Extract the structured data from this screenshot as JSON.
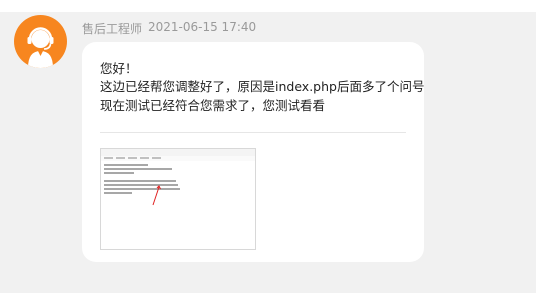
{
  "sender": {
    "name": "售后工程师",
    "timestamp": "2021-06-15 17:40",
    "avatar_icon": "support-agent-headset-icon",
    "avatar_color": "#f7861f"
  },
  "message": {
    "lines": [
      "您好！",
      "这边已经帮您调整好了，原因是index.php后面多了个问号",
      "现在测试已经符合您需求了，您测试看看"
    ],
    "attachment": {
      "type": "screenshot-thumbnail",
      "description_icon": "notepad-screenshot-icon"
    }
  }
}
